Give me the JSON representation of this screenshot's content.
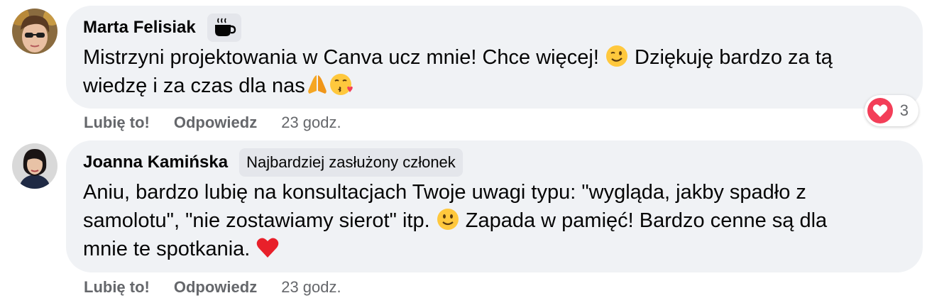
{
  "comments": [
    {
      "author": "Marta Felisiak",
      "badge_icon": "coffee-cup-icon",
      "text_line1_a": "Mistrzyni projektowania w Canva ucz mnie! Chce więcej! ",
      "text_line1_b": " Dziękuję bardzo za tą",
      "text_line2": "wiedzę i za czas dla nas",
      "emojis": [
        "winking-face-emoji",
        "folded-hands-emoji",
        "face-blowing-kiss-emoji"
      ],
      "like_label": "Lubię to!",
      "reply_label": "Odpowiedz",
      "time": "23 godz.",
      "reaction_icon": "heart-reaction-icon",
      "reaction_count": "3"
    },
    {
      "author": "Joanna Kamińska",
      "badge": "Najbardziej zasłużony członek",
      "text_line1": "Aniu, bardzo lubię na konsultacjach Twoje uwagi typu: \"wygląda, jakby spadło z",
      "text_line2_a": "samolotu\", \"nie zostawiamy sierot\" itp. ",
      "text_line2_b": " Zapada w pamięć! Bardzo cenne są dla",
      "text_line3": "mnie te spotkania. ",
      "emojis": [
        "slightly-smiling-face-emoji",
        "red-heart-emoji"
      ],
      "like_label": "Lubię to!",
      "reply_label": "Odpowiedz",
      "time": "23 godz."
    }
  ],
  "colors": {
    "bubble": "#f0f2f5",
    "badge": "#e4e6eb",
    "secondary_text": "#65676b",
    "heart": "#f33e58"
  }
}
